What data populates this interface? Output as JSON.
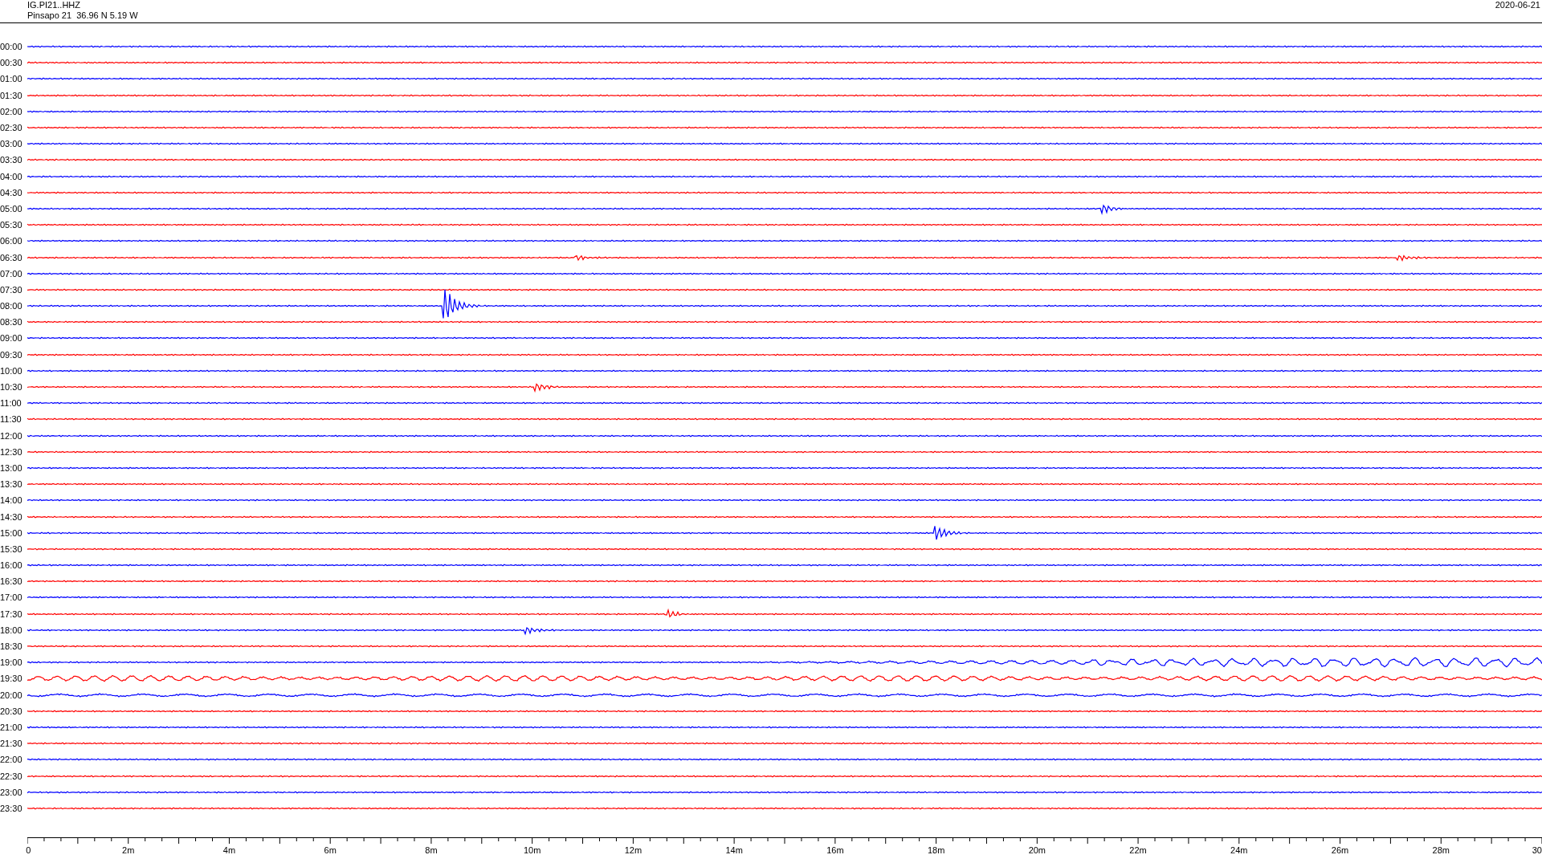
{
  "header": {
    "station": "IG.PI21..HHZ",
    "location": "Pinsapo 21  36.96 N 5.19 W",
    "date": "2020-06-21"
  },
  "rows": [
    {
      "time": "00:00",
      "color": "#0000ff"
    },
    {
      "time": "00:30",
      "color": "#ff0000"
    },
    {
      "time": "01:00",
      "color": "#0000ff"
    },
    {
      "time": "01:30",
      "color": "#ff0000"
    },
    {
      "time": "02:00",
      "color": "#0000ff"
    },
    {
      "time": "02:30",
      "color": "#ff0000"
    },
    {
      "time": "03:00",
      "color": "#0000ff"
    },
    {
      "time": "03:30",
      "color": "#ff0000"
    },
    {
      "time": "04:00",
      "color": "#0000ff"
    },
    {
      "time": "04:30",
      "color": "#ff0000"
    },
    {
      "time": "05:00",
      "color": "#0000ff"
    },
    {
      "time": "05:30",
      "color": "#ff0000"
    },
    {
      "time": "06:00",
      "color": "#0000ff"
    },
    {
      "time": "06:30",
      "color": "#ff0000"
    },
    {
      "time": "07:00",
      "color": "#0000ff"
    },
    {
      "time": "07:30",
      "color": "#ff0000"
    },
    {
      "time": "08:00",
      "color": "#0000ff"
    },
    {
      "time": "08:30",
      "color": "#ff0000"
    },
    {
      "time": "09:00",
      "color": "#0000ff"
    },
    {
      "time": "09:30",
      "color": "#ff0000"
    },
    {
      "time": "10:00",
      "color": "#0000ff"
    },
    {
      "time": "10:30",
      "color": "#ff0000"
    },
    {
      "time": "11:00",
      "color": "#0000ff"
    },
    {
      "time": "11:30",
      "color": "#ff0000"
    },
    {
      "time": "12:00",
      "color": "#0000ff"
    },
    {
      "time": "12:30",
      "color": "#ff0000"
    },
    {
      "time": "13:00",
      "color": "#0000ff"
    },
    {
      "time": "13:30",
      "color": "#ff0000"
    },
    {
      "time": "14:00",
      "color": "#0000ff"
    },
    {
      "time": "14:30",
      "color": "#ff0000"
    },
    {
      "time": "15:00",
      "color": "#0000ff"
    },
    {
      "time": "15:30",
      "color": "#ff0000"
    },
    {
      "time": "16:00",
      "color": "#0000ff"
    },
    {
      "time": "16:30",
      "color": "#ff0000"
    },
    {
      "time": "17:00",
      "color": "#0000ff"
    },
    {
      "time": "17:30",
      "color": "#ff0000"
    },
    {
      "time": "18:00",
      "color": "#0000ff"
    },
    {
      "time": "18:30",
      "color": "#ff0000"
    },
    {
      "time": "19:00",
      "color": "#0000ff"
    },
    {
      "time": "19:30",
      "color": "#ff0000"
    },
    {
      "time": "20:00",
      "color": "#0000ff"
    },
    {
      "time": "20:30",
      "color": "#ff0000"
    },
    {
      "time": "21:00",
      "color": "#0000ff"
    },
    {
      "time": "21:30",
      "color": "#ff0000"
    },
    {
      "time": "22:00",
      "color": "#0000ff"
    },
    {
      "time": "22:30",
      "color": "#ff0000"
    },
    {
      "time": "23:00",
      "color": "#0000ff"
    },
    {
      "time": "23:30",
      "color": "#ff0000"
    }
  ],
  "axis": {
    "labels": [
      "0",
      "2m",
      "4m",
      "6m",
      "8m",
      "10m",
      "12m",
      "14m",
      "16m",
      "18m",
      "20m",
      "22m",
      "24m",
      "26m",
      "28m",
      "30"
    ]
  }
}
